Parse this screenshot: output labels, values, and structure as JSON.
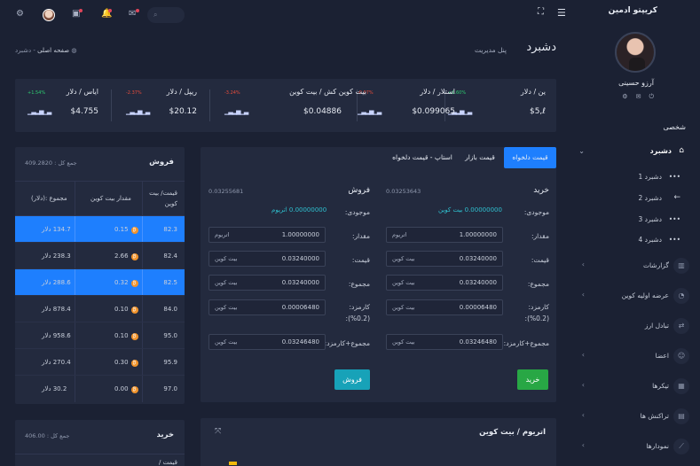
{
  "sidebar": {
    "brand": "کریپتو ادمین",
    "user_name": "آرزو حسینی",
    "section_title": "شخصی",
    "dashboard_label": "دشبرد",
    "sub_items": [
      {
        "label": "دشبرد 1"
      },
      {
        "label": "دشبرد 2"
      },
      {
        "label": "دشبرد 3"
      },
      {
        "label": "دشبرد 4"
      }
    ],
    "items": [
      {
        "label": "گزارشات",
        "icon": "chart-icon"
      },
      {
        "label": "عرضه اولیه کوین",
        "icon": "coin-icon"
      },
      {
        "label": "تبادل ارز",
        "icon": "exchange-icon"
      },
      {
        "label": "اعضا",
        "icon": "members-icon"
      },
      {
        "label": "تیکرها",
        "icon": "ticker-icon"
      },
      {
        "label": "تراکنش ها",
        "icon": "transactions-icon"
      },
      {
        "label": "نمودارها",
        "icon": "graphs-icon"
      }
    ]
  },
  "topbar": {
    "search_placeholder": ""
  },
  "page": {
    "title": "دشبرد",
    "subtitle": "پنل مدیریت",
    "breadcrumb_home": "صفحه اصلی",
    "breadcrumb_sep": "-",
    "breadcrumb_current": "دشبرد"
  },
  "tickers": [
    {
      "pair": "ین / دلار",
      "change": "+1.60%",
      "price": "$5,ℓ",
      "color": "#2ecc71"
    },
    {
      "pair": "استلار / دلار",
      "change": "-0.97%",
      "price": "$0.099065",
      "color": "#e74c3c"
    },
    {
      "pair": "بیت کوین کش / بیت کوین",
      "change": "-3.24%",
      "price": "$0.04886",
      "color": "#e74c3c"
    },
    {
      "pair": "ریپل / دلار",
      "change": "-2.37%",
      "price": "$20.12",
      "color": "#e74c3c"
    },
    {
      "pair": "ایاس / دلار",
      "change": "+1.54%",
      "price": "$4.755",
      "color": "#2ecc71"
    }
  ],
  "sell_book": {
    "title": "فروش",
    "total": "جمع کل : 409.2820",
    "headers": {
      "price": "قیمت/ بیت کوین",
      "amount": "مقدار بیت کوین",
      "total": "مجموع :(دلار)"
    },
    "rows": [
      {
        "price": "82.3",
        "amount": "0.15",
        "total": "134.7 دلار",
        "highlight": true
      },
      {
        "price": "82.4",
        "amount": "2.66",
        "total": "238.3 دلار",
        "highlight": false
      },
      {
        "price": "82.5",
        "amount": "0.32",
        "total": "288.6 دلار",
        "highlight": true
      },
      {
        "price": "84.0",
        "amount": "0.10",
        "total": "878.4 دلار",
        "highlight": false
      },
      {
        "price": "95.0",
        "amount": "0.10",
        "total": "958.6 دلار",
        "highlight": false
      },
      {
        "price": "95.9",
        "amount": "0.30",
        "total": "270.4 دلار",
        "highlight": false
      },
      {
        "price": "97.0",
        "amount": "0.00",
        "total": "30.2 دلار",
        "highlight": false
      }
    ]
  },
  "buy_book": {
    "title": "خرید",
    "total": "جمع کل : 406.00",
    "header_price": "قیمت /"
  },
  "trade": {
    "tabs": [
      "قیمت دلخواه",
      "قیمت بازار",
      "استاپ - قیمت دلخواه"
    ],
    "buy": {
      "title": "خرید",
      "rate": "0.03253643",
      "balance_label": "موجودی:",
      "balance": "0.00000000 بیت کوین",
      "fields": [
        {
          "label": "مقدار:",
          "value": "1.00000000",
          "unit": "اتریوم"
        },
        {
          "label": "قیمت:",
          "value": "0.03240000",
          "unit": "بیت کوین"
        },
        {
          "label": "مجموع:",
          "value": "0.03240000",
          "unit": "بیت کوین"
        },
        {
          "label": "کارمزد:",
          "label2": "(%0.2):",
          "value": "0.00006480",
          "unit": "بیت کوین"
        },
        {
          "label": "مجموع+کارمزد:",
          "value": "0.03246480",
          "unit": "بیت کوین"
        }
      ],
      "button": "خرید"
    },
    "sell": {
      "title": "فروش",
      "rate": "0.03255681",
      "balance_label": "موجودی:",
      "balance": "0.00000000 اتریوم",
      "fields": [
        {
          "label": "مقدار:",
          "value": "1.00000000",
          "unit": "اتریوم"
        },
        {
          "label": "قیمت:",
          "value": "0.03240000",
          "unit": "بیت کوین"
        },
        {
          "label": "مجموع:",
          "value": "0.03240000",
          "unit": "بیت کوین"
        },
        {
          "label": "کارمزد:",
          "label2": "(%0.2):",
          "value": "0.00006480",
          "unit": "بیت کوین"
        },
        {
          "label": "مجموع+کارمزد:",
          "value": "0.03246480",
          "unit": "بیت کوین"
        }
      ],
      "button": "فروش"
    }
  },
  "chart_card": {
    "title": "اتریوم / بیت کوین"
  },
  "colors": {
    "bg": "#1b2133",
    "card": "#232a3e",
    "accent": "#1e7ffe",
    "buy_button": "#28a745",
    "sell_button": "#17a2b8"
  }
}
